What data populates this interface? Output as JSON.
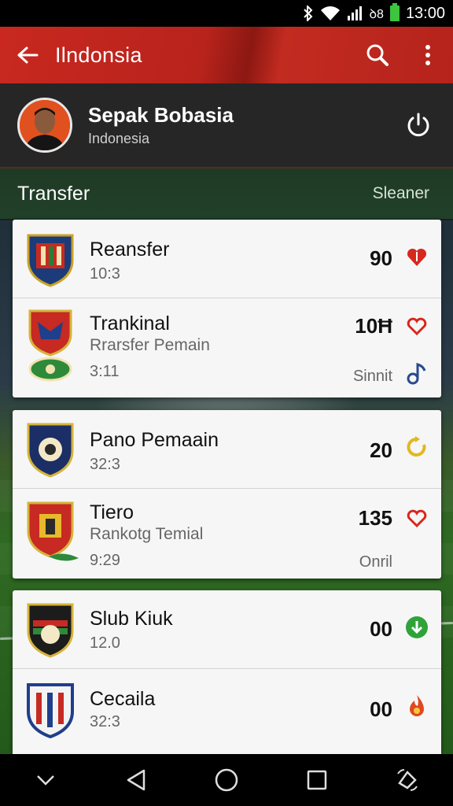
{
  "status": {
    "network": "◢",
    "signal_text": "ıl",
    "lte": "̸₂₈",
    "time": "13:00"
  },
  "app_bar": {
    "title": "Ilndonsia"
  },
  "profile": {
    "name": "Sepak Bobasia",
    "subtitle": "Indonesia"
  },
  "section": {
    "label": "Transfer",
    "right_label": "Sleaner"
  },
  "cards": [
    {
      "rows": [
        {
          "name": "Reansfer",
          "time": "10:3",
          "value": "90",
          "icon": "heart-icon",
          "icon_color": "#d7281e"
        },
        {
          "name": "Trankinal",
          "sub": "Rrarsfer Pemain",
          "time": "3:11",
          "value": "10Ħ",
          "extra": "Sinnit",
          "icon": "heart-outline-icon",
          "icon_color": "#d7281e",
          "icon2": "music-note-icon",
          "icon2_color": "#2a4a8c"
        }
      ]
    },
    {
      "rows": [
        {
          "name": "Pano Pemaain",
          "time": "32:3",
          "value": "20",
          "icon": "refresh-icon",
          "icon_color": "#e2b81f"
        },
        {
          "name": "Tiero",
          "sub": "Rankotg Temial",
          "time": "9:29",
          "value": "135",
          "extra": "Onril",
          "icon": "heart-outline-icon",
          "icon_color": "#d7281e"
        }
      ]
    },
    {
      "rows": [
        {
          "name": "Slub Kiuk",
          "time": "12.0",
          "value": "00",
          "icon": "download-icon",
          "icon_color": "#2fa33a"
        },
        {
          "name": "Cecaila",
          "time": "32:3",
          "value": "00",
          "icon": "flame-icon",
          "icon_color": "#e0481e"
        }
      ]
    }
  ]
}
